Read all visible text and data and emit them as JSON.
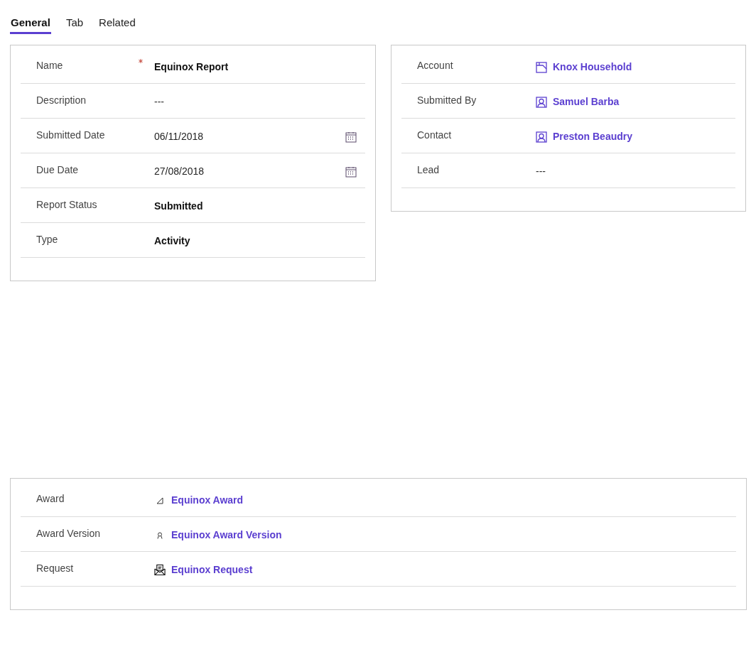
{
  "tabs": [
    {
      "label": "General",
      "selected": true
    },
    {
      "label": "Tab",
      "selected": false
    },
    {
      "label": "Related",
      "selected": false
    }
  ],
  "left_section": {
    "fields": [
      {
        "label": "Name",
        "required": true,
        "kind": "text",
        "value": "Equinox Report"
      },
      {
        "label": "Description",
        "required": false,
        "kind": "empty",
        "value": "---"
      },
      {
        "label": "Submitted Date",
        "required": false,
        "kind": "date",
        "value": "06/11/2018"
      },
      {
        "label": "Due Date",
        "required": false,
        "kind": "date",
        "value": "27/08/2018"
      },
      {
        "label": "Report Status",
        "required": false,
        "kind": "text",
        "value": "Submitted"
      },
      {
        "label": "Type",
        "required": false,
        "kind": "text",
        "value": "Activity"
      }
    ]
  },
  "right_section": {
    "fields": [
      {
        "label": "Account",
        "kind": "account",
        "value": "Knox Household"
      },
      {
        "label": "Submitted By",
        "kind": "person",
        "value": "Samuel Barba"
      },
      {
        "label": "Contact",
        "kind": "person",
        "value": "Preston Beaudry"
      },
      {
        "label": "Lead",
        "kind": "empty",
        "value": "---"
      }
    ]
  },
  "bottom_section": {
    "fields": [
      {
        "label": "Award",
        "kind": "award",
        "value": "Equinox Award"
      },
      {
        "label": "Award Version",
        "kind": "version",
        "value": "Equinox Award Version"
      },
      {
        "label": "Request",
        "kind": "request",
        "value": "Equinox Request"
      }
    ]
  }
}
